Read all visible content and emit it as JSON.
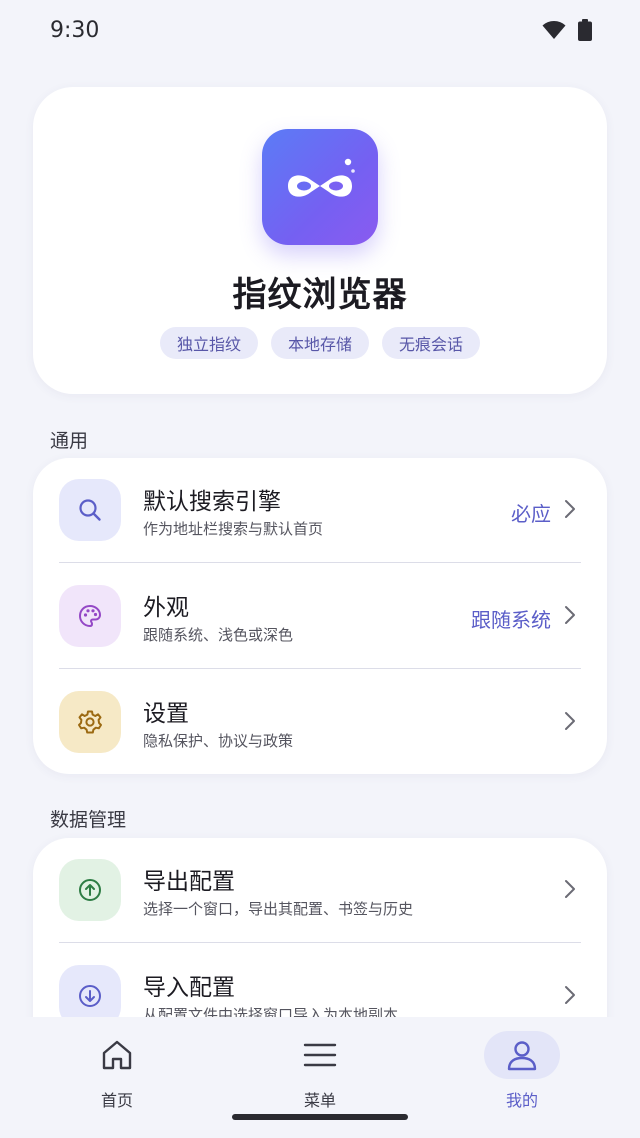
{
  "status_bar": {
    "time": "9:30"
  },
  "hero": {
    "app_name": "指纹浏览器",
    "chips": [
      "独立指纹",
      "本地存储",
      "无痕会话"
    ]
  },
  "sections": {
    "general": {
      "title": "通用",
      "items": [
        {
          "title": "默认搜索引擎",
          "subtitle": "作为地址栏搜索与默认首页",
          "value": "必应",
          "icon": "search-icon"
        },
        {
          "title": "外观",
          "subtitle": "跟随系统、浅色或深色",
          "value": "跟随系统",
          "icon": "palette-icon"
        },
        {
          "title": "设置",
          "subtitle": "隐私保护、协议与政策",
          "value": "",
          "icon": "gear-icon"
        }
      ]
    },
    "data": {
      "title": "数据管理",
      "items": [
        {
          "title": "导出配置",
          "subtitle": "选择一个窗口，导出其配置、书签与历史",
          "icon": "upload-icon"
        },
        {
          "title": "导入配置",
          "subtitle": "从配置文件中选择窗口导入为本地副本",
          "icon": "download-icon"
        }
      ]
    }
  },
  "bottom_nav": {
    "items": [
      {
        "label": "首页",
        "icon": "home-icon"
      },
      {
        "label": "菜单",
        "icon": "menu-icon"
      },
      {
        "label": "我的",
        "icon": "profile-icon"
      }
    ],
    "active_index": 2
  },
  "colors": {
    "accent": "#5b5ec8",
    "background": "#f3f4fa",
    "logo_gradient_start": "#5b7cf6",
    "logo_gradient_end": "#8a5bf0"
  }
}
